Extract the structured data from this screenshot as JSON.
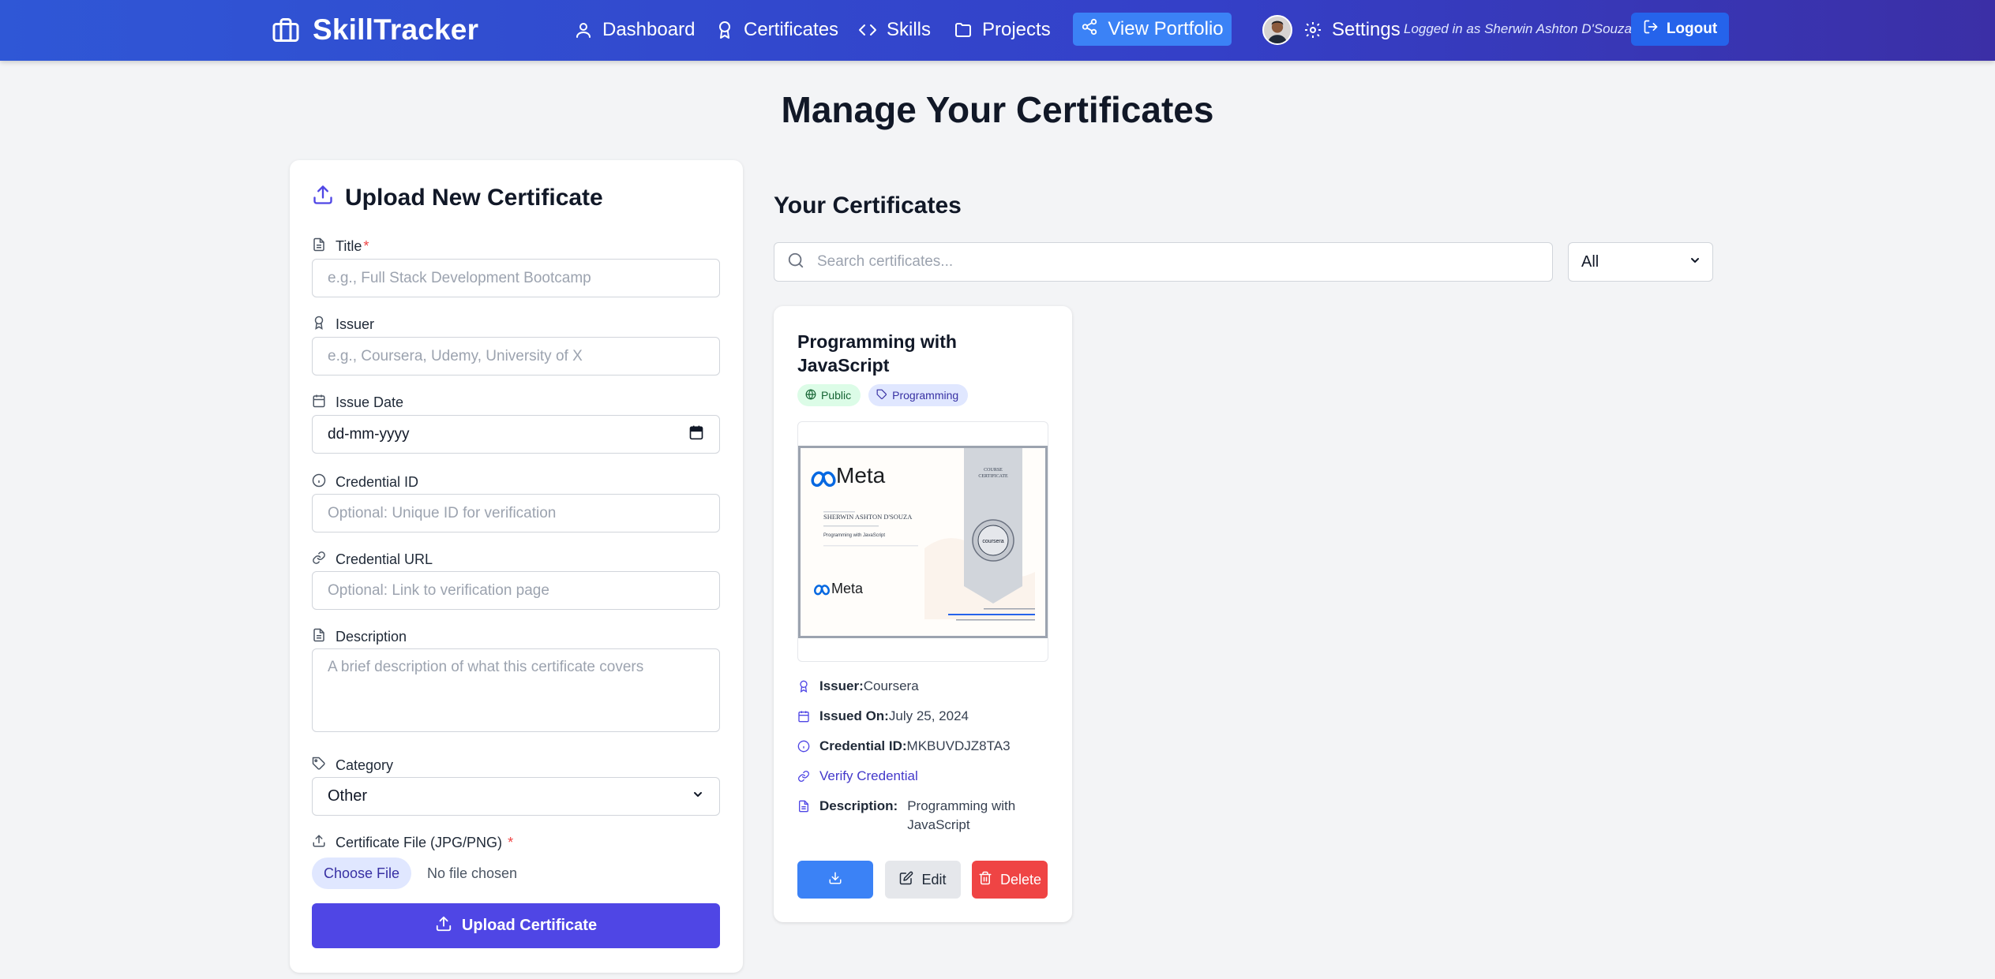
{
  "app": {
    "name": "SkillTracker"
  },
  "nav": {
    "dashboard": "Dashboard",
    "certificates": "Certificates",
    "skills": "Skills",
    "projects": "Projects",
    "portfolio": "View Portfolio",
    "settings": "Settings",
    "logged_in": "Logged in as Sherwin Ashton D'Souza",
    "logout": "Logout"
  },
  "page": {
    "title": "Manage Your Certificates"
  },
  "form": {
    "heading": "Upload New Certificate",
    "title_label": "Title",
    "title_placeholder": "e.g., Full Stack Development Bootcamp",
    "issuer_label": "Issuer",
    "issuer_placeholder": "e.g., Coursera, Udemy, University of X",
    "date_label": "Issue Date",
    "date_value": "dd-mm-yyyy",
    "credential_id_label": "Credential ID",
    "credential_id_placeholder": "Optional: Unique ID for verification",
    "credential_url_label": "Credential URL",
    "credential_url_placeholder": "Optional: Link to verification page",
    "description_label": "Description",
    "description_placeholder": "A brief description of what this certificate covers",
    "category_label": "Category",
    "category_value": "Other",
    "file_label": "Certificate File (JPG/PNG)",
    "choose_file": "Choose File",
    "no_file": "No file chosen",
    "upload_button": "Upload Certificate",
    "required_mark": "*"
  },
  "list": {
    "heading": "Your Certificates",
    "search_placeholder": "Search certificates...",
    "filter_value": "All"
  },
  "certificate": {
    "title": "Programming with JavaScript",
    "visibility": "Public",
    "category": "Programming",
    "issuer_label": "Issuer:",
    "issuer": "Coursera",
    "issued_label": "Issued On:",
    "issued": "July 25, 2024",
    "credential_label": "Credential ID:",
    "credential_id": "MKBUVDJZ8TA3",
    "verify": "Verify Credential",
    "description_label": "Description:",
    "description": "Programming with JavaScript",
    "edit": "Edit",
    "delete": "Delete",
    "image": {
      "brand": "Meta",
      "brand_footer": "Meta",
      "badge_line1": "COURSE",
      "badge_line2": "CERTIFICATE",
      "recipient": "SHERWIN ASHTON D'SOUZA",
      "course": "Programming with JavaScript",
      "seal": "coursera"
    }
  },
  "colors": {
    "nav_gradient_start": "#2f57d6",
    "nav_gradient_end": "#3b2fa6",
    "primary": "#4f46e5",
    "accent_blue": "#3b82f6",
    "danger": "#ef4444"
  }
}
